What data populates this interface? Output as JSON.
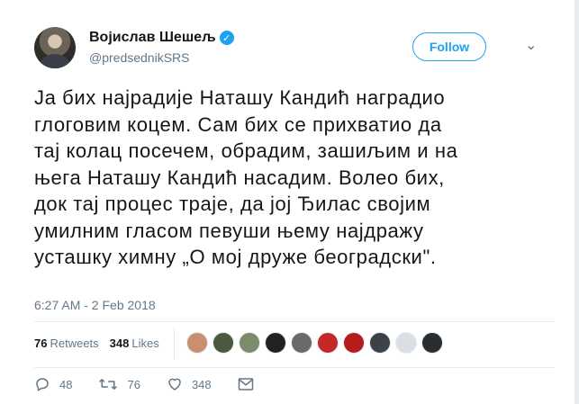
{
  "user": {
    "display_name": "Војислав Шешељ",
    "handle": "@predsednikSRS",
    "verified_glyph": "✓"
  },
  "follow_label": "Follow",
  "caret_glyph": "⌄",
  "tweet": {
    "text": "Ја бих најрадије Наташу Кандић наградио\nглоговим коцем. Сам бих се прихватио да\nтај колац посечем, обрадим, зашиљим и на\nњега Наташу Кандић насадим. Волео бих,\nдок тај процес траје, да јој Ђилас својим\nумилним гласом певуши њему најдражу\nусташку химну „О мој друже београдски\"."
  },
  "timestamp": "6:27 AM - 2 Feb 2018",
  "stats": {
    "retweets_count": "76",
    "retweets_label": "Retweets",
    "likes_count": "348",
    "likes_label": "Likes"
  },
  "liker_avatars": [
    "#c98f6e",
    "#4b5a3f",
    "#7b8c6d",
    "#222222",
    "#6a6a6a",
    "#c62828",
    "#b71c1c",
    "#3d4148",
    "#d9dfe4",
    "#2b2e31"
  ],
  "actions": {
    "reply_count": "48",
    "retweet_count": "76",
    "like_count": "348"
  }
}
